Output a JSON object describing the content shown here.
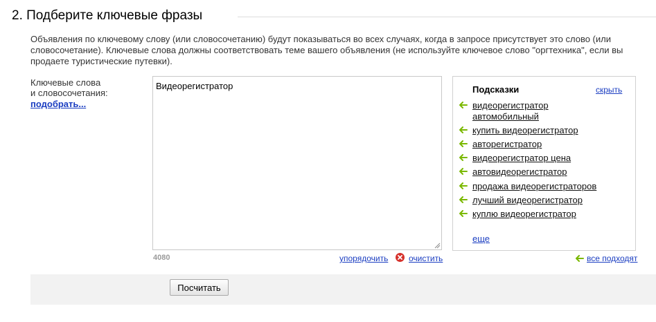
{
  "section": {
    "title": "2. Подберите ключевые фразы",
    "description": "Объявления по ключевому слову (или словосочетанию) будут показываться во всех случаях, когда в запросе присутствует это слово (или словосочетание). Ключевые слова должны соответствовать теме вашего объявления (не используйте ключевое слово \"оргтехника\", если вы продаете туристические путевки)."
  },
  "keywords": {
    "label_line1": "Ключевые слова",
    "label_line2": "и словосочетания:",
    "pick_link": "подобрать...",
    "value": "Видеорегистратор",
    "char_count": "4080",
    "sort_link": "упорядочить",
    "clear_link": "очистить"
  },
  "hints": {
    "title": "Подсказки",
    "hide_link": "скрыть",
    "items": [
      "видеорегистратор автомобильный",
      "купить видеорегистратор",
      "авторегистратор",
      "видеорегистратор цена",
      "автовидеорегистратор",
      "продажа видеорегистраторов",
      "лучший видеорегистратор",
      "куплю видеорегистратор"
    ],
    "more_link": "еще",
    "all_fit_link": "все подходят"
  },
  "actions": {
    "calculate_button": "Посчитать"
  },
  "icons": {
    "hint_arrow": "green-left-arrow-icon",
    "clear": "red-x-circle-icon"
  },
  "colors": {
    "link": "#1a3dc1",
    "arrow_green": "#7ab800",
    "clear_red": "#d6322c"
  }
}
